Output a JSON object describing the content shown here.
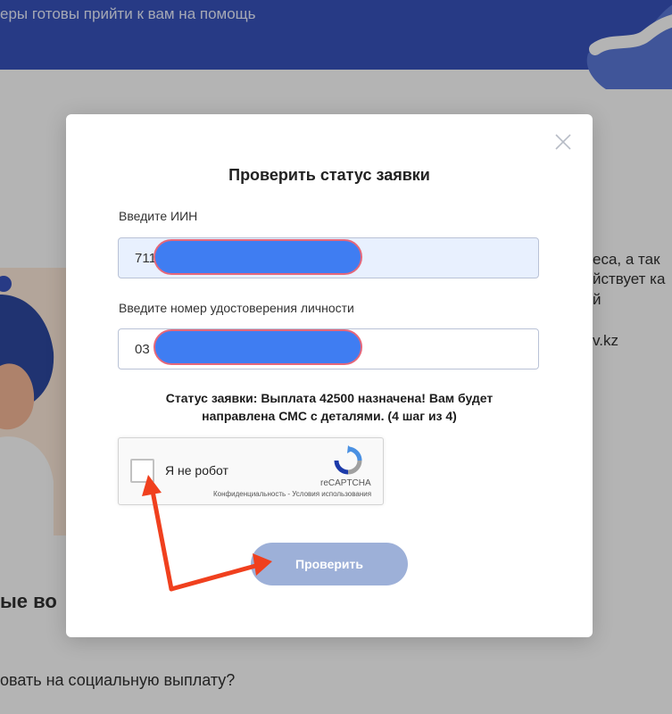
{
  "background": {
    "header_text": "еры готовы прийти к вам на помощь",
    "right_lines": [
      "еса, а так",
      "йствует ка",
      "й",
      "v.kz"
    ],
    "bottom_heading": "ые во",
    "bottom_question": "овать на социальную выплату?"
  },
  "modal": {
    "title": "Проверить статус заявки",
    "iin": {
      "label": "Введите ИИН",
      "value": "711"
    },
    "id_number": {
      "label": "Введите номер удостоверения личности",
      "value": "03"
    },
    "status_line1": "Статус заявки: Выплата 42500 назначена! Вам будет",
    "status_line2": "направлена СМС с деталями. (4 шаг из 4)",
    "captcha": {
      "label": "Я не робот",
      "brand": "reCAPTCHA",
      "links": "Конфиденциальность - Условия использования"
    },
    "submit_label": "Проверить"
  },
  "colors": {
    "header_blue": "#2a47b8",
    "button_disabled": "#9db0d8",
    "redaction_blue": "#3f7df2",
    "arrow_red": "#f0401e"
  }
}
